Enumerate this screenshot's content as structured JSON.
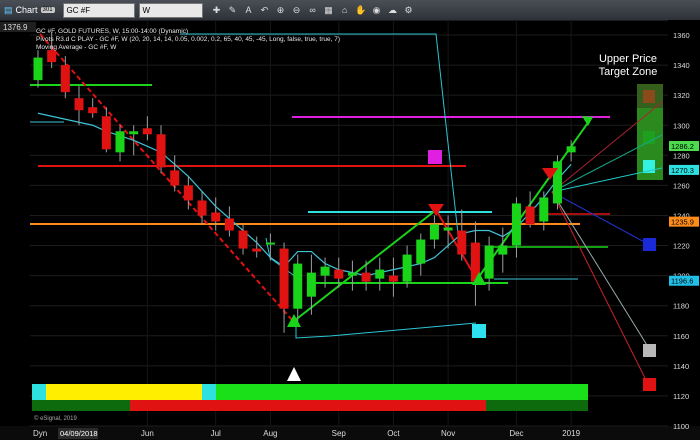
{
  "window": {
    "title": "Chart",
    "badge": "301",
    "symbol": "GC #F",
    "interval": "W",
    "toolbar_icons": [
      "crosshair-icon",
      "pencil-icon",
      "text-icon",
      "undo-icon",
      "zoom-in-icon",
      "zoom-out-icon",
      "link-icon",
      "grid-icon",
      "home-icon",
      "hand-icon",
      "eye-icon",
      "cloud-icon",
      "settings-icon"
    ]
  },
  "legend": {
    "line1": "GC #F, GOLD FUTURES, W, 15:00-14:00 (Dynamic)",
    "line2": "Pivots R3.d C PLAY - GC #F, W (20, 20, 14, 14, 0.05, 0.002, 0.2, 65, 40, 45, -45, Long, false, true, true, 7)",
    "line3": "Moving Average - GC #F, W"
  },
  "annotation": {
    "line1": "Upper Price",
    "line2": "Target Zone"
  },
  "footer": {
    "brand": "© eSignal, 2019",
    "dyn_label": "Dyn",
    "date_label": "04/09/2018"
  },
  "colors": {
    "bull": "#19d419",
    "bear": "#e01212",
    "wick": "#9aa0a6",
    "ma": "#3ec3d6",
    "axis_bg": "#000000",
    "price_tag_current": "#ff8c1a",
    "price_tag_1270": "#2de1e1",
    "price_tag_1286": "#4ddc4d",
    "price_tag_1196": "#20c0e8"
  },
  "chart_data": {
    "type": "candlestick",
    "ylim": [
      1100,
      1370
    ],
    "y_ticks": [
      1100,
      1120,
      1140,
      1160,
      1180,
      1200,
      1220,
      1240,
      1260,
      1280,
      1300,
      1320,
      1340,
      1360
    ],
    "top_price_label": "1376.9",
    "x_tick_labels": [
      {
        "label": "Jun",
        "index": 8
      },
      {
        "label": "Jul",
        "index": 13
      },
      {
        "label": "Aug",
        "index": 17
      },
      {
        "label": "Sep",
        "index": 22
      },
      {
        "label": "Oct",
        "index": 26
      },
      {
        "label": "Nov",
        "index": 30
      },
      {
        "label": "Dec",
        "index": 35
      },
      {
        "label": "2019",
        "index": 39
      }
    ],
    "candles": [
      {
        "o": 1330,
        "h": 1350,
        "l": 1325,
        "c": 1345
      },
      {
        "o": 1350,
        "h": 1362,
        "l": 1338,
        "c": 1342
      },
      {
        "o": 1340,
        "h": 1346,
        "l": 1318,
        "c": 1322
      },
      {
        "o": 1318,
        "h": 1326,
        "l": 1300,
        "c": 1310
      },
      {
        "o": 1312,
        "h": 1318,
        "l": 1305,
        "c": 1308
      },
      {
        "o": 1306,
        "h": 1312,
        "l": 1282,
        "c": 1284
      },
      {
        "o": 1282,
        "h": 1300,
        "l": 1276,
        "c": 1296
      },
      {
        "o": 1294,
        "h": 1300,
        "l": 1280,
        "c": 1296
      },
      {
        "o": 1298,
        "h": 1306,
        "l": 1290,
        "c": 1294
      },
      {
        "o": 1294,
        "h": 1300,
        "l": 1268,
        "c": 1272
      },
      {
        "o": 1270,
        "h": 1280,
        "l": 1256,
        "c": 1260
      },
      {
        "o": 1260,
        "h": 1266,
        "l": 1244,
        "c": 1250
      },
      {
        "o": 1250,
        "h": 1256,
        "l": 1234,
        "c": 1240
      },
      {
        "o": 1242,
        "h": 1252,
        "l": 1230,
        "c": 1236
      },
      {
        "o": 1238,
        "h": 1246,
        "l": 1226,
        "c": 1230
      },
      {
        "o": 1230,
        "h": 1234,
        "l": 1214,
        "c": 1218
      },
      {
        "o": 1218,
        "h": 1226,
        "l": 1212,
        "c": 1216
      },
      {
        "o": 1222,
        "h": 1228,
        "l": 1210,
        "c": 1222
      },
      {
        "o": 1218,
        "h": 1222,
        "l": 1162,
        "c": 1178
      },
      {
        "o": 1178,
        "h": 1214,
        "l": 1166,
        "c": 1208
      },
      {
        "o": 1186,
        "h": 1214,
        "l": 1174,
        "c": 1202
      },
      {
        "o": 1200,
        "h": 1212,
        "l": 1192,
        "c": 1206
      },
      {
        "o": 1204,
        "h": 1212,
        "l": 1192,
        "c": 1198
      },
      {
        "o": 1200,
        "h": 1210,
        "l": 1190,
        "c": 1202
      },
      {
        "o": 1202,
        "h": 1210,
        "l": 1190,
        "c": 1196
      },
      {
        "o": 1198,
        "h": 1212,
        "l": 1190,
        "c": 1204
      },
      {
        "o": 1200,
        "h": 1212,
        "l": 1186,
        "c": 1196
      },
      {
        "o": 1196,
        "h": 1220,
        "l": 1192,
        "c": 1214
      },
      {
        "o": 1208,
        "h": 1228,
        "l": 1200,
        "c": 1224
      },
      {
        "o": 1224,
        "h": 1240,
        "l": 1218,
        "c": 1234
      },
      {
        "o": 1230,
        "h": 1240,
        "l": 1218,
        "c": 1232
      },
      {
        "o": 1230,
        "h": 1244,
        "l": 1210,
        "c": 1214
      },
      {
        "o": 1222,
        "h": 1236,
        "l": 1180,
        "c": 1196
      },
      {
        "o": 1198,
        "h": 1226,
        "l": 1190,
        "c": 1220
      },
      {
        "o": 1214,
        "h": 1232,
        "l": 1202,
        "c": 1220
      },
      {
        "o": 1220,
        "h": 1252,
        "l": 1212,
        "c": 1248
      },
      {
        "o": 1246,
        "h": 1256,
        "l": 1232,
        "c": 1234
      },
      {
        "o": 1236,
        "h": 1256,
        "l": 1230,
        "c": 1252
      },
      {
        "o": 1248,
        "h": 1280,
        "l": 1244,
        "c": 1276
      },
      {
        "o": 1282,
        "h": 1290,
        "l": 1276,
        "c": 1286
      }
    ],
    "moving_average": [
      1308,
      1306,
      1304,
      1302,
      1300,
      1296,
      1293,
      1290,
      1286,
      1282,
      1274,
      1266,
      1256,
      1246,
      1238,
      1230,
      1222,
      1212,
      1206,
      1216,
      1216,
      1208,
      1204,
      1202,
      1200,
      1202,
      1204,
      1206,
      1208,
      1212,
      1220,
      1228,
      1230,
      1230,
      1226,
      1232,
      1242,
      1252,
      1264,
      1274
    ],
    "price_tags": [
      {
        "label": "1286.2",
        "value": 1286.2,
        "color": "#4ddc4d"
      },
      {
        "label": "1270.3",
        "value": 1270.3,
        "color": "#2de1e1"
      },
      {
        "label": "1235.9",
        "value": 1235.9,
        "color": "#ff8c1a"
      },
      {
        "label": "1196.6",
        "value": 1196.6,
        "color": "#20c0e8"
      }
    ]
  }
}
